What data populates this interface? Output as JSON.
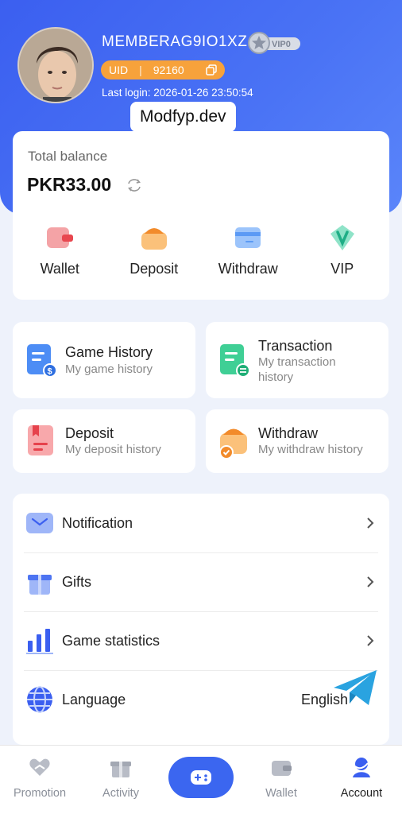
{
  "profile": {
    "username": "MEMBERAG9IO1XZ",
    "vip_label": "VIP0",
    "uid_label": "UID",
    "uid_sep": "|",
    "uid_value": "92160",
    "last_login": "Last login: 2026-01-26 23:50:54"
  },
  "watermark": "Modfyp.dev",
  "balance": {
    "label": "Total balance",
    "value": "PKR33.00"
  },
  "quick_actions": [
    {
      "label": "Wallet",
      "icon": "wallet-icon"
    },
    {
      "label": "Deposit",
      "icon": "deposit-icon"
    },
    {
      "label": "Withdraw",
      "icon": "withdraw-icon"
    },
    {
      "label": "VIP",
      "icon": "vip-icon"
    }
  ],
  "tiles": [
    {
      "title": "Game History",
      "subtitle": "My game history"
    },
    {
      "title": "Transaction",
      "subtitle_line1": "My transaction",
      "subtitle_line2": "history"
    },
    {
      "title": "Deposit",
      "subtitle": "My deposit history"
    },
    {
      "title": "Withdraw",
      "subtitle": "My withdraw history"
    }
  ],
  "settings": [
    {
      "label": "Notification"
    },
    {
      "label": "Gifts"
    },
    {
      "label": "Game statistics"
    },
    {
      "label": "Language",
      "value": "English"
    }
  ],
  "tabbar": [
    {
      "label": "Promotion"
    },
    {
      "label": "Activity"
    },
    {
      "label": "Wallet"
    },
    {
      "label": "Account"
    }
  ],
  "colors": {
    "primary": "#3b66f0",
    "accent_orange": "#f7a23b"
  }
}
